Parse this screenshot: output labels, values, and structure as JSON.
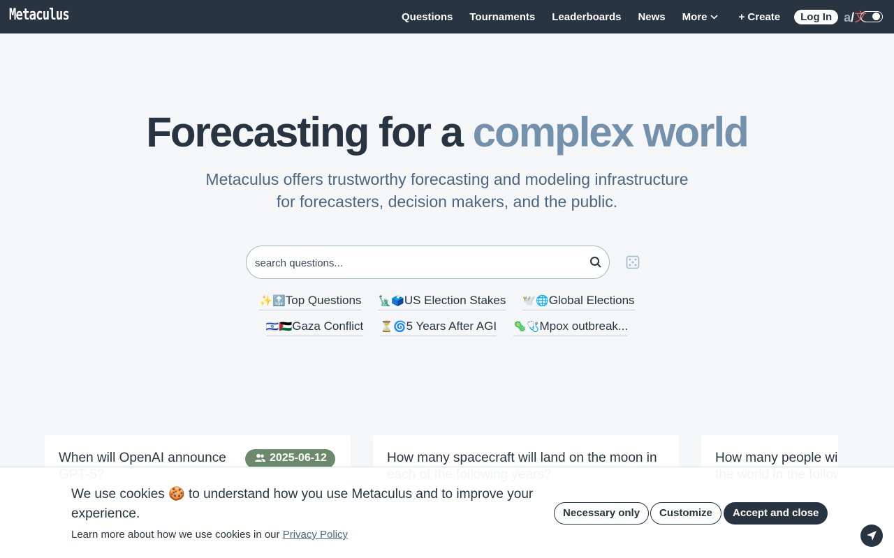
{
  "nav": {
    "logo": "Metaculus",
    "links": [
      "Questions",
      "Tournaments",
      "Leaderboards",
      "News"
    ],
    "more_label": "More",
    "create_label": "+ Create",
    "login_label": "Log In",
    "lang_a": "a",
    "lang_sep": "/",
    "lang_zh": "文"
  },
  "hero": {
    "title_main": "Forecasting for a ",
    "title_accent": "complex world",
    "subtitle": "Metaculus offers trustworthy forecasting and modeling infrastructure for forecasters, decision makers, and the public."
  },
  "search": {
    "placeholder": "search questions..."
  },
  "chips": [
    {
      "emoji": "✨🔝",
      "label": "Top Questions"
    },
    {
      "emoji": "🗽🗳️",
      "label": "US Election Stakes"
    },
    {
      "emoji": "🕊️🌐",
      "label": "Global Elections"
    },
    {
      "emoji": "🇮🇱🇵🇸",
      "label": "Gaza Conflict"
    },
    {
      "emoji": "⏳🌀",
      "label": "5 Years After AGI"
    },
    {
      "emoji": "🦠🩺",
      "label": "Mpox outbreak..."
    }
  ],
  "cards": [
    {
      "title": "When will OpenAI announce GPT-5?",
      "badge": "2025-06-12"
    },
    {
      "title": "How many spacecraft will land on the moon in each of the following years?"
    },
    {
      "title": "How many people will live in democracies in the world in the following years?"
    }
  ],
  "cookie": {
    "text": "We use cookies 🍪 to understand how you use Metaculus and to improve your experience.",
    "small_text": "Learn more about how we use cookies in our ",
    "policy_link": "Privacy Policy",
    "necessary": "Necessary only",
    "customize": "Customize",
    "accept": "Accept and close"
  }
}
